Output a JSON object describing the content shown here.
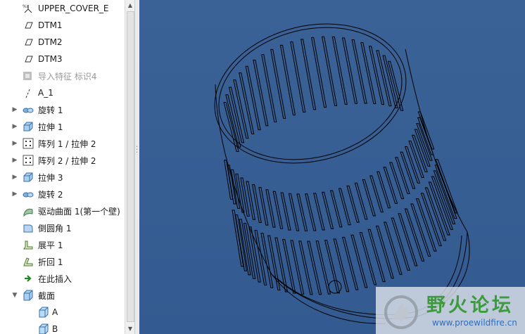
{
  "model_tree": {
    "items": [
      {
        "label": "UPPER_COVER_E",
        "icon": "coordinate-system-icon",
        "expandable": false,
        "dim": false
      },
      {
        "label": "DTM1",
        "icon": "datum-plane-icon",
        "expandable": false,
        "dim": false
      },
      {
        "label": "DTM2",
        "icon": "datum-plane-icon",
        "expandable": false,
        "dim": false
      },
      {
        "label": "DTM3",
        "icon": "datum-plane-icon",
        "expandable": false,
        "dim": false
      },
      {
        "label": "导入特征 标识4",
        "icon": "import-feature-icon",
        "expandable": false,
        "dim": true
      },
      {
        "label": "A_1",
        "icon": "datum-axis-icon",
        "expandable": false,
        "dim": false
      },
      {
        "label": "旋转 1",
        "icon": "revolve-icon",
        "expandable": true,
        "dim": false
      },
      {
        "label": "拉伸 1",
        "icon": "extrude-icon",
        "expandable": true,
        "dim": false
      },
      {
        "label": "阵列 1 / 拉伸 2",
        "icon": "pattern-icon",
        "expandable": true,
        "dim": false
      },
      {
        "label": "阵列 2 / 拉伸 2",
        "icon": "pattern-icon",
        "expandable": true,
        "dim": false
      },
      {
        "label": "拉伸 3",
        "icon": "extrude-icon",
        "expandable": true,
        "dim": false
      },
      {
        "label": "旋转 2",
        "icon": "revolve-icon",
        "expandable": true,
        "dim": false
      },
      {
        "label": "驱动曲面 1(第一个壁)",
        "icon": "driving-surface-icon",
        "expandable": false,
        "dim": false
      },
      {
        "label": "倒圆角 1",
        "icon": "round-icon",
        "expandable": false,
        "dim": false
      },
      {
        "label": "展平 1",
        "icon": "flatten-icon",
        "expandable": false,
        "dim": false
      },
      {
        "label": "折回 1",
        "icon": "fold-back-icon",
        "expandable": false,
        "dim": false
      },
      {
        "label": "在此插入",
        "icon": "insert-here-arrow-icon",
        "expandable": false,
        "dim": false
      },
      {
        "label": "截面",
        "icon": "section-icon",
        "expandable": true,
        "expanded": true,
        "dim": false
      },
      {
        "label": "A",
        "icon": "section-item-icon",
        "expandable": false,
        "dim": false,
        "child": true
      },
      {
        "label": "B",
        "icon": "section-item-icon",
        "expandable": false,
        "dim": false,
        "child": true
      }
    ]
  },
  "colors": {
    "viewport_background": "#3a6195",
    "model_edges": "#000000",
    "watermark_green": "#3e9a3e",
    "watermark_blue": "#2e6fbf"
  },
  "watermark": {
    "title": "野火论坛",
    "url": "www.proewildfire.cn",
    "icon": "fire-logo-icon"
  }
}
